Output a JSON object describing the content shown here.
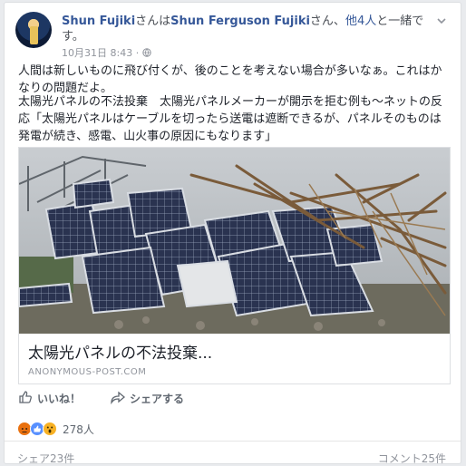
{
  "post": {
    "author": "Shun Fujiki",
    "with_prefix": "さんは",
    "tagged": "Shun Ferguson Fujiki",
    "with_suffix": "さん、",
    "others": "他4人",
    "with_end": "と一緒で",
    "with_end2": "す。",
    "timestamp": "10月31日 8:43 ·",
    "text1": "人間は新しいものに飛び付くが、後のことを考えない場合が多いなぁ。これはかなりの問題だよ。",
    "text2": "太陽光パネルの不法投棄　太陽光パネルメーカーが開示を拒む例も〜ネットの反応「太陽光パネルはケーブルを切ったら送電は遮断できるが、パネルそのものは発電が続き、感電、山火事の原因にもなります」"
  },
  "link_card": {
    "title": "太陽光パネルの不法投棄...",
    "domain": "ANONYMOUS-POST.COM"
  },
  "actions": {
    "like": "いいね！",
    "share": "シェアする"
  },
  "reactions": {
    "count": "278人",
    "icons": [
      "angry-icon",
      "like-icon",
      "wow-icon"
    ]
  },
  "footer": {
    "shares": "シェア23件",
    "comments": "コメント25件"
  },
  "colors": {
    "link_blue": "#365899",
    "meta_gray": "#90949c",
    "like_blue": "#5890ff",
    "angry_orange": "#e9710f",
    "wow_yellow": "#f7b125"
  }
}
